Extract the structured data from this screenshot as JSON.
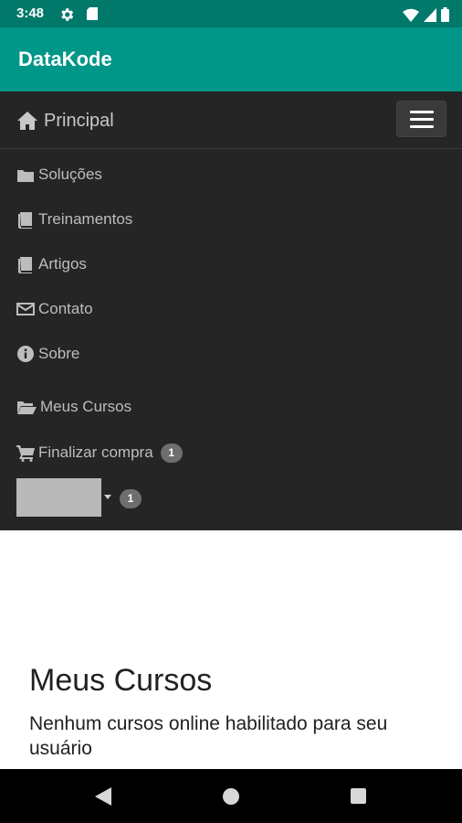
{
  "status_bar": {
    "time": "3:48",
    "icons": [
      "gear-icon",
      "sd-card-icon",
      "wifi-icon",
      "signal-icon",
      "battery-icon"
    ]
  },
  "app_bar": {
    "title": "DataKode"
  },
  "navbar": {
    "brand": {
      "label": "Principal",
      "icon": "home-icon"
    },
    "toggle_icon": "hamburger-menu-icon",
    "items": [
      {
        "label": "Soluções",
        "icon": "folder-icon"
      },
      {
        "label": "Treinamentos",
        "icon": "book-icon"
      },
      {
        "label": "Artigos",
        "icon": "book-icon"
      },
      {
        "label": "Contato",
        "icon": "envelope-icon"
      },
      {
        "label": "Sobre",
        "icon": "info-circle-icon"
      },
      {
        "label": "Meus Cursos",
        "icon": "folder-open-icon"
      },
      {
        "label": "Finalizar compra",
        "icon": "cart-icon",
        "badge": "1"
      }
    ],
    "user_menu": {
      "badge": "1",
      "icon": "caret-down-icon"
    }
  },
  "main": {
    "title": "Meus Cursos",
    "description": "Nenhum cursos online habilitado para seu usuário"
  },
  "colors": {
    "status_bar": "#00796b",
    "app_bar": "#009688",
    "navbar": "#252525",
    "nav_text": "#bdbdbd",
    "badge": "#6e6e6e"
  }
}
